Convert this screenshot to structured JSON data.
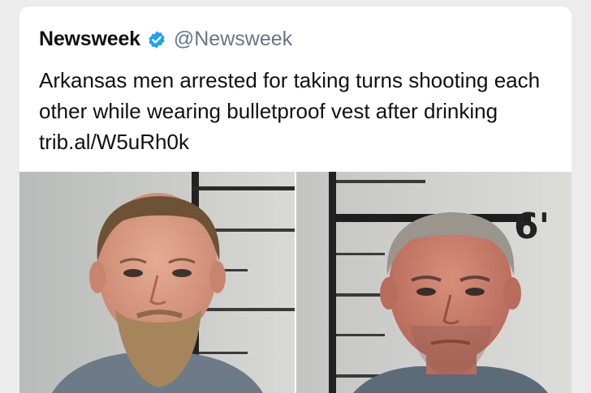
{
  "tweet": {
    "display_name": "Newsweek",
    "handle": "@Newsweek",
    "text": "Arkansas men arrested for taking turns shooting each other while wearing bulletproof vest after drinking trib.al/W5uRh0k",
    "verified_icon": "verified-badge-icon"
  },
  "photos": [
    {
      "name": "mugshot-left"
    },
    {
      "name": "mugshot-right",
      "height_marker": "6'"
    }
  ],
  "colors": {
    "verified": "#1da1f2",
    "handle": "#657786",
    "text": "#111111"
  }
}
